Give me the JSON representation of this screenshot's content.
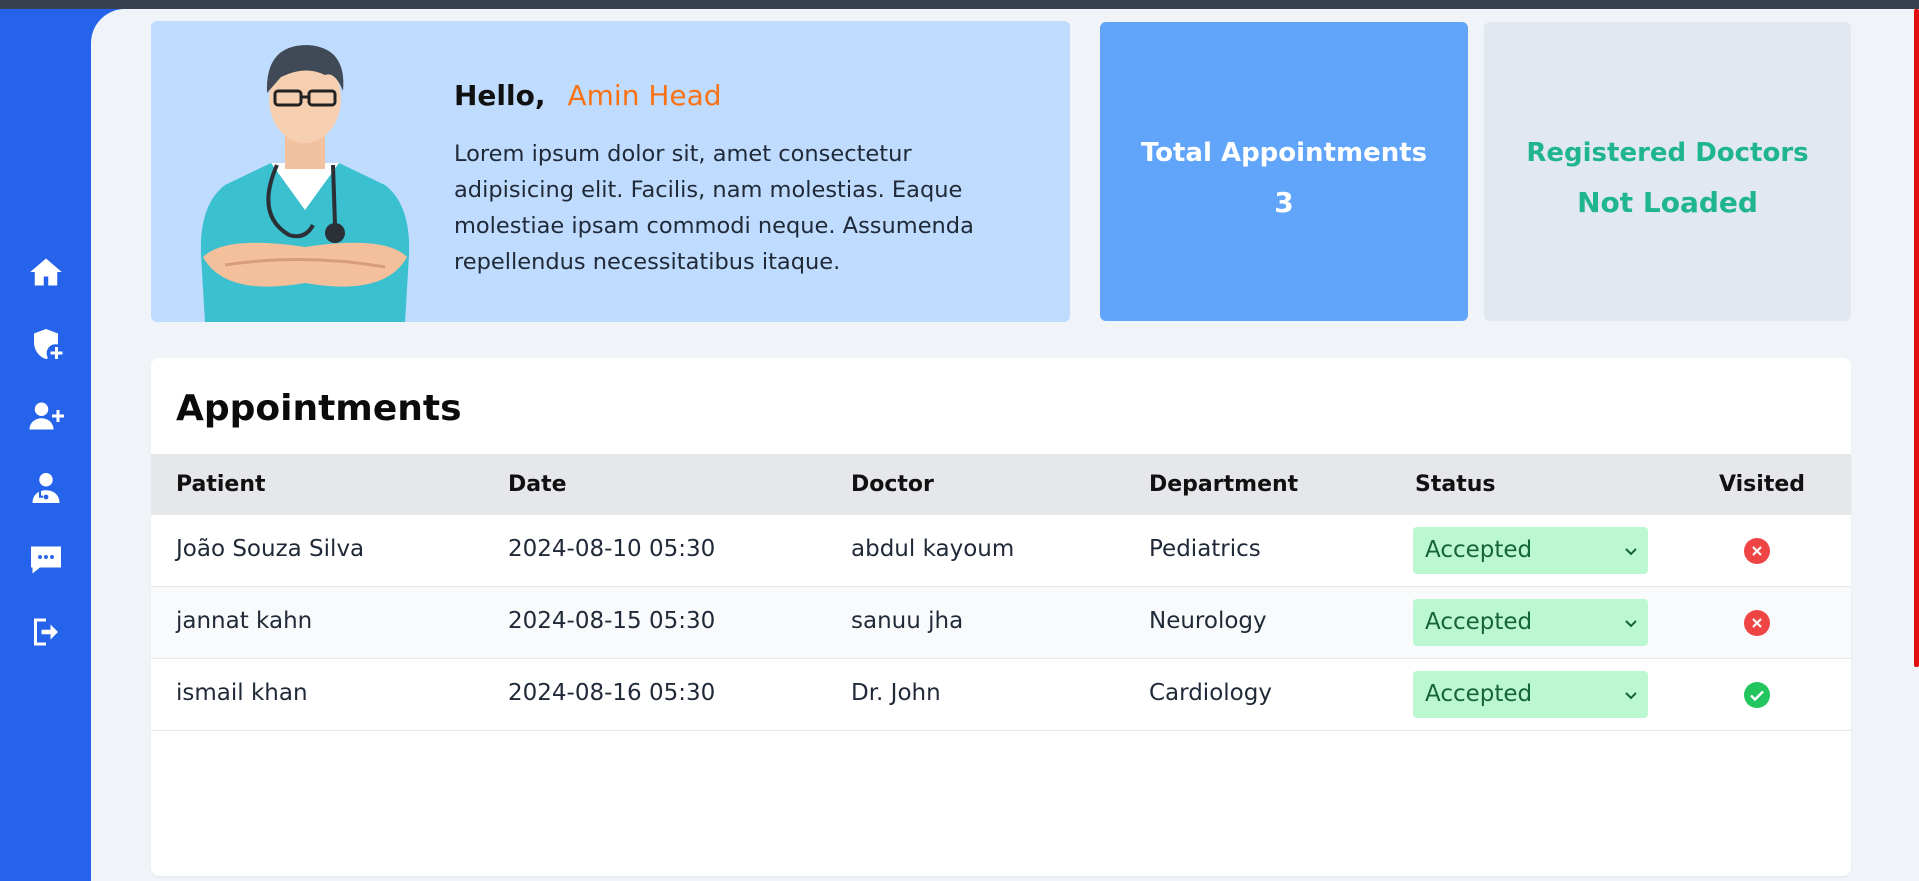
{
  "sidebar": {
    "items": [
      {
        "icon": "home-icon"
      },
      {
        "icon": "shield-plus-icon"
      },
      {
        "icon": "user-plus-icon"
      },
      {
        "icon": "doctor-icon"
      },
      {
        "icon": "chat-icon"
      },
      {
        "icon": "logout-icon"
      }
    ]
  },
  "hero": {
    "greeting": "Hello,",
    "user_name": "Amin Head",
    "description": "Lorem ipsum dolor sit, amet consectetur adipisicing elit. Facilis, nam molestias. Eaque molestiae ipsam commodi neque. Assumenda repellendus necessitatibus itaque."
  },
  "stats": {
    "total_label": "Total Appointments",
    "total_value": "3",
    "doctors_label": "Registered Doctors",
    "doctors_value": "Not Loaded"
  },
  "appointments": {
    "title": "Appointments",
    "columns": [
      "Patient",
      "Date",
      "Doctor",
      "Department",
      "Status",
      "Visited"
    ],
    "rows": [
      {
        "patient": "João Souza Silva",
        "date": "2024-08-10 05:30",
        "doctor": "abdul kayoum",
        "department": "Pediatrics",
        "status": "Accepted",
        "visited": "no"
      },
      {
        "patient": "jannat kahn",
        "date": "2024-08-15 05:30",
        "doctor": "sanuu jha",
        "department": "Neurology",
        "status": "Accepted",
        "visited": "no"
      },
      {
        "patient": "ismail khan",
        "date": "2024-08-16 05:30",
        "doctor": "Dr. John",
        "department": "Cardiology",
        "status": "Accepted",
        "visited": "yes"
      }
    ]
  },
  "colors": {
    "sidebar": "#2563eb",
    "accent_name": "#f97316",
    "doctors_stat": "#1fb58f",
    "status_bg": "#bbf7d0",
    "visited_no": "#ef4444",
    "visited_yes": "#22c55e"
  }
}
